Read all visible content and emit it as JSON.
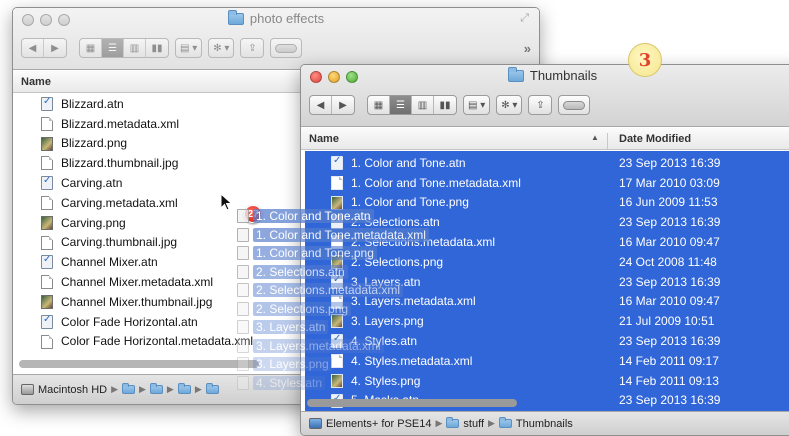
{
  "back_window": {
    "title": "photo effects",
    "column_name": "Name",
    "files": [
      {
        "name": "Blizzard.atn",
        "icon": "atn"
      },
      {
        "name": "Blizzard.metadata.xml",
        "icon": "doc"
      },
      {
        "name": "Blizzard.png",
        "icon": "img"
      },
      {
        "name": "Blizzard.thumbnail.jpg",
        "icon": "doc"
      },
      {
        "name": "Carving.atn",
        "icon": "atn"
      },
      {
        "name": "Carving.metadata.xml",
        "icon": "doc"
      },
      {
        "name": "Carving.png",
        "icon": "img"
      },
      {
        "name": "Carving.thumbnail.jpg",
        "icon": "doc"
      },
      {
        "name": "Channel Mixer.atn",
        "icon": "atn"
      },
      {
        "name": "Channel Mixer.metadata.xml",
        "icon": "doc"
      },
      {
        "name": "Channel Mixer.thumbnail.jpg",
        "icon": "img"
      },
      {
        "name": "Color Fade Horizontal.atn",
        "icon": "atn"
      },
      {
        "name": "Color Fade Horizontal.metadata.xml",
        "icon": "doc"
      }
    ],
    "path": [
      "Macintosh HD"
    ]
  },
  "front_window": {
    "title": "Thumbnails",
    "column_name": "Name",
    "column_date": "Date Modified",
    "files": [
      {
        "name": "1. Color and Tone.atn",
        "date": "23 Sep 2013 16:39",
        "icon": "atn"
      },
      {
        "name": "1. Color and Tone.metadata.xml",
        "date": "17 Mar 2010 03:09",
        "icon": "doc"
      },
      {
        "name": "1. Color and Tone.png",
        "date": "16 Jun 2009 11:53",
        "icon": "img"
      },
      {
        "name": "2. Selections.atn",
        "date": "23 Sep 2013 16:39",
        "icon": "atn"
      },
      {
        "name": "2. Selections.metadata.xml",
        "date": "16 Mar 2010 09:47",
        "icon": "doc"
      },
      {
        "name": "2. Selections.png",
        "date": "24 Oct 2008 11:48",
        "icon": "img"
      },
      {
        "name": "3. Layers.atn",
        "date": "23 Sep 2013 16:39",
        "icon": "atn"
      },
      {
        "name": "3. Layers.metadata.xml",
        "date": "16 Mar 2010 09:47",
        "icon": "doc"
      },
      {
        "name": "3. Layers.png",
        "date": "21 Jul 2009 10:51",
        "icon": "img"
      },
      {
        "name": "4. Styles.atn",
        "date": "23 Sep 2013 16:39",
        "icon": "atn"
      },
      {
        "name": "4. Styles.metadata.xml",
        "date": "14 Feb 2011 09:17",
        "icon": "doc"
      },
      {
        "name": "4. Styles.png",
        "date": "14 Feb 2011 09:13",
        "icon": "img"
      },
      {
        "name": "5. Masks.atn",
        "date": "23 Sep 2013 16:39",
        "icon": "atn"
      }
    ],
    "path": [
      "Elements+ for PSE14",
      "stuff",
      "Thumbnails"
    ]
  },
  "drag": {
    "count": "27",
    "items": [
      "1. Color and Tone.atn",
      "1. Color and Tone.metadata.xml",
      "1. Color and Tone.png",
      "2. Selections.atn",
      "2. Selections.metadata.xml",
      "2. Selections.png",
      "3. Layers.atn",
      "3. Layers.metadata.xml",
      "3. Layers.png",
      "4. Styles.atn"
    ]
  },
  "step": "3",
  "colors": {
    "selection": "#3166d8",
    "badge": "#d01c0f",
    "step_number": "#e0452a"
  }
}
